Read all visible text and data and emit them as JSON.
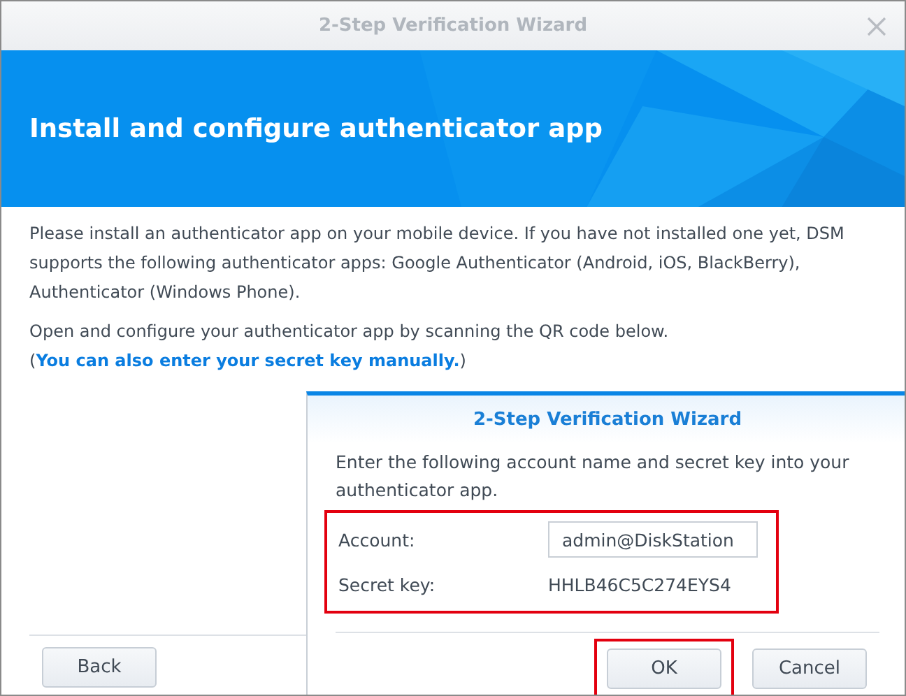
{
  "window": {
    "title": "2-Step Verification Wizard"
  },
  "banner": {
    "heading": "Install and configure authenticator app"
  },
  "body": {
    "paragraph": "Please install an authenticator app on your mobile device. If you have not installed one yet, DSM supports the following authenticator apps: Google Authenticator (Android, iOS, BlackBerry), Authenticator (Windows Phone).",
    "instruction": {
      "text": "Open and configure your authenticator app by scanning the QR code below. (",
      "link": "You can also enter your secret key manually.",
      "after": ")"
    }
  },
  "footer": {
    "back_button": "Back"
  },
  "dialog": {
    "title": "2-Step Verification Wizard",
    "description": "Enter the following account name and secret key into your authenticator app.",
    "fields_highlighted": true,
    "fields": [
      {
        "kind": "input",
        "label": "Account:",
        "value": "admin@DiskStation"
      },
      {
        "kind": "text",
        "label": "Secret key:",
        "value": "HHLB46C5C274EYS4"
      }
    ],
    "buttons": [
      {
        "label": "OK",
        "highlighted": true
      },
      {
        "label": "Cancel",
        "highlighted": false
      }
    ]
  }
}
